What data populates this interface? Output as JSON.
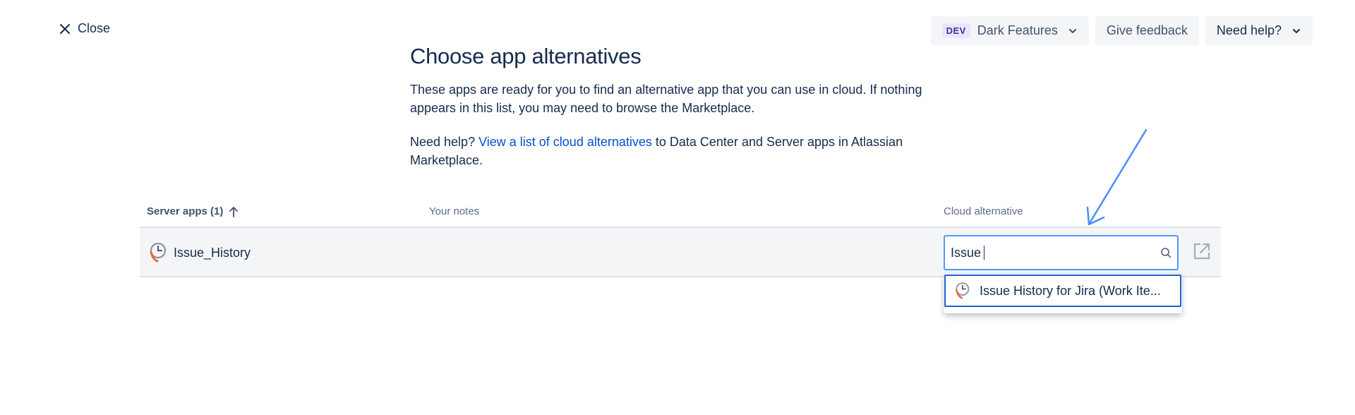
{
  "header": {
    "close_label": "Close",
    "dev_badge": "DEV",
    "dark_features_label": "Dark Features",
    "give_feedback_label": "Give feedback",
    "need_help_label": "Need help?"
  },
  "main": {
    "title": "Choose app alternatives",
    "description": "These apps are ready for you to find an alternative app that you can use in cloud. If nothing appears in this list, you may need to browse the Marketplace.",
    "help_prefix": "Need help? ",
    "help_link": "View a list of cloud alternatives",
    "help_suffix": " to Data Center and Server apps in Atlassian Marketplace."
  },
  "table": {
    "columns": [
      "Server apps (1)",
      "Your notes",
      "Cloud alternative"
    ],
    "rows": [
      {
        "app_name": "Issue_History",
        "notes": "",
        "search_value": "Issue"
      }
    ]
  },
  "dropdown": {
    "options": [
      "Issue History for Jira (Work Ite..."
    ]
  },
  "colors": {
    "accent": "#0052cc",
    "focus_border": "#4c9aff",
    "annotation_arrow": "#4c8dfa"
  },
  "icons": [
    "close-icon",
    "chevron-down-icon",
    "sort-arrow-up-icon",
    "app-logo-icon",
    "search-icon",
    "external-link-icon"
  ]
}
